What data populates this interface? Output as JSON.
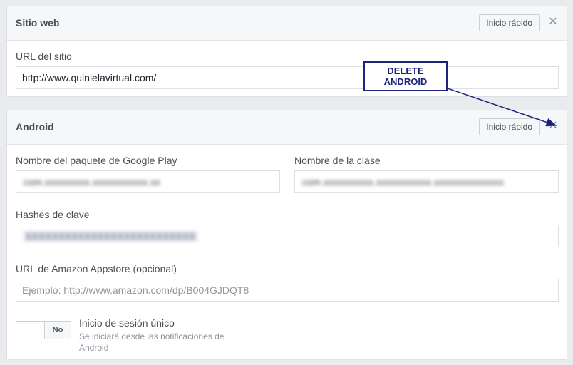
{
  "website_panel": {
    "title": "Sitio web",
    "quick_start": "Inicio rápido",
    "close_glyph": "✕",
    "url_label": "URL del sitio",
    "url_value": "http://www.quinielavirtual.com/"
  },
  "android_panel": {
    "title": "Android",
    "quick_start": "Inicio rápido",
    "close_glyph": "✕",
    "package_label": "Nombre del paquete de Google Play",
    "package_value": "com.xxxxxxxxx.xxxxxxxxxxx.xx",
    "class_label": "Nombre de la clase",
    "class_value": "com.xxxxxxxxxx.xxxxxxxxxxx.xxxxxxxxxxxxxx",
    "hashes_label": "Hashes de clave",
    "hashes_value": "XXXXXXXXXXXXXXXXXXXXXXXXXX",
    "amazon_label": "URL de Amazon Appstore (opcional)",
    "amazon_placeholder": "Ejemplo: http://www.amazon.com/dp/B004GJDQT8",
    "sso_toggle_label": "No",
    "sso_title": "Inicio de sesión único",
    "sso_description": "Se iniciará desde las notificaciones de Android"
  },
  "annotation": {
    "line1": "DELETE",
    "line2": "ANDROID",
    "color": "#1a237e"
  }
}
